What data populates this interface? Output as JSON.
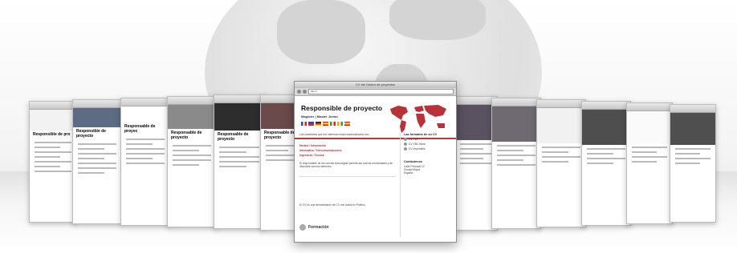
{
  "browser": {
    "title": "CV del Gestor de proyectos",
    "url": "http://..."
  },
  "cv": {
    "title": "Responsible de proyecto",
    "subtitle": "Magister | Master    Junior",
    "intro": "Los candidatos que me interesan están especializados con:",
    "skills": [
      "Medios / Información",
      "Informática / Telecomunicaciones",
      "Ingeniería / Técnica"
    ],
    "body": "El responsable de las nuevas tecnologías permite las nuevas necesidades y de descubrir nuevos intereses.",
    "footer": "El CV es una demostración de CV con datos en Público.",
    "section": "Formación",
    "sidebar": {
      "heading": "Las formatos de su CV",
      "items": [
        "CV PDF",
        "CV XML Word",
        "CV Imprimible"
      ],
      "contact_heading": "Contáctenos",
      "contact_lines": [
        "Calle Principal 12",
        "Ciudad Mayor",
        "España"
      ]
    }
  },
  "left_card_titles": [
    "Responsible de pro",
    "Responsible de proyecto",
    "Responsable de proyec",
    "Responsable de proyecto",
    "Responsable de proyecto",
    "Responsable de proyecto"
  ],
  "colors": {
    "accent": "#b23a3f",
    "map": "#b8323a"
  }
}
